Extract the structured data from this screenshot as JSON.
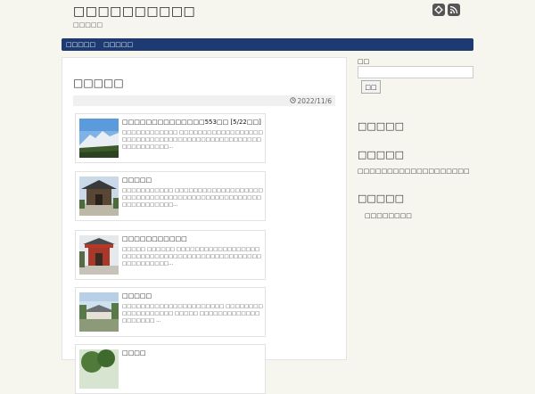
{
  "header": {
    "site_title": "□□□□□□□□□□",
    "site_description": "□□□□□",
    "social_icons": [
      "feedly-icon",
      "rss-icon"
    ]
  },
  "nav": {
    "items": [
      {
        "label": "□□□□□"
      },
      {
        "label": "□□□□□"
      }
    ],
    "color": "#1d3a72"
  },
  "main": {
    "page_heading": "□□□□□",
    "date": "2022/11/6",
    "posts": [
      {
        "title": "□□□□□□□□□□□□□□553□□ [5/22□□]",
        "excerpt": "□□□□□□□□□□□□ □□□□□□□□□□□□□□□□□□□□□□□□□□□□□□□□□□□□□□□□□□□□□□□□□□□□□□□□□□...",
        "thumb": "mountain"
      },
      {
        "title": "□□□□□",
        "excerpt": "□□□□□□□□□□□ □□□□□□□□□□□□□□□□□□□□□□□□□□□□□□□□□□□□□□□□□□□□□□□□□□□□□□□□□□□□...",
        "thumb": "shrine-gate"
      },
      {
        "title": "□□□□□□□□□□□",
        "excerpt": "□□□□□ □□□□□□ □□□□□□□□□□□□□□□□□□□□□□□□□□□□□□□□□□□□□□□□□□□□□□□□□□□□□□□□□□...",
        "thumb": "red-shrine"
      },
      {
        "title": "□□□□□",
        "excerpt": "□□□□□□□□□□□□□□□□□□□□□□ □□□□□□□□□□□□□□□□□□□ □□□□□ □□□□□□□□□□□□□□□□□□□□ ...",
        "thumb": "temple-hall"
      },
      {
        "title": "□□□□",
        "excerpt": "",
        "thumb": "tree"
      }
    ]
  },
  "sidebar": {
    "search_label": "□□",
    "search_placeholder": "",
    "search_button": "□□",
    "widgets": [
      {
        "title": "□□□□□"
      },
      {
        "title": "□□□□□",
        "text": "□□□□□□□□□□□□□□□□□□□"
      },
      {
        "title": "□□□□□",
        "link": "□□□□□□□□"
      }
    ]
  }
}
